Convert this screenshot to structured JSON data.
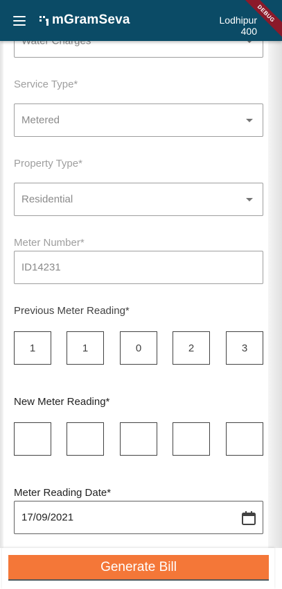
{
  "app_bar": {
    "title": "mGramSeva",
    "location_line1": "Lodhipur",
    "location_line2": "400",
    "debug_badge": "DEBUG",
    "brand_color": "#0B4B66"
  },
  "form": {
    "charge_type": {
      "value": "Water Charges"
    },
    "service_type": {
      "label": "Service Type*",
      "value": "Metered"
    },
    "property_type": {
      "label": "Property Type*",
      "value": "Residential"
    },
    "meter_number": {
      "label": "Meter Number*",
      "value": "ID14231"
    },
    "previous_reading": {
      "label": "Previous Meter Reading*",
      "digits": [
        "1",
        "1",
        "0",
        "2",
        "3"
      ]
    },
    "new_reading": {
      "label": "New Meter Reading*",
      "digits": [
        "",
        "",
        "",
        "",
        ""
      ]
    },
    "reading_date": {
      "label": "Meter Reading Date*",
      "value": "17/09/2021"
    }
  },
  "footer": {
    "generate_label": "Generate Bill",
    "button_color": "#F47738"
  }
}
